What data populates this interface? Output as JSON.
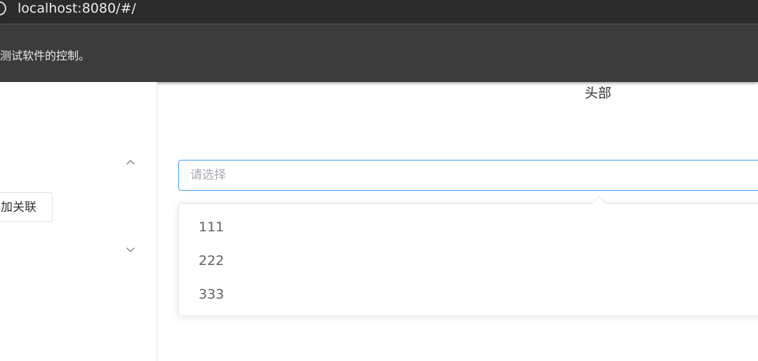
{
  "browser": {
    "url": "localhost:8080/#/",
    "infobar_text": "测试软件的控制。"
  },
  "sidebar": {
    "add_button_label": "加关联"
  },
  "main": {
    "header_title": "头部",
    "select": {
      "placeholder": "请选择",
      "value": "",
      "options": [
        "111",
        "222",
        "333"
      ]
    }
  },
  "colors": {
    "accent": "#409eff",
    "browser_chrome": "#2b2b2b",
    "infobar": "#3c3c3c"
  }
}
